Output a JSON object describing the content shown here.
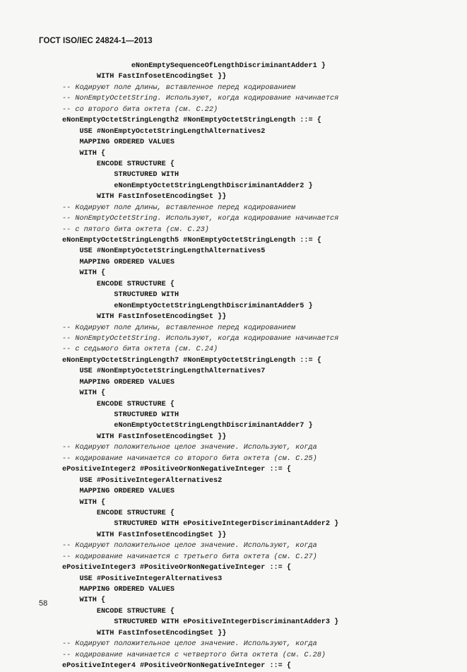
{
  "document": {
    "header": "ГОСТ ISO/IEC 24824-1—2013",
    "page_number": "58"
  },
  "code": {
    "lines": [
      {
        "text": "                eNonEmptySequenceOfLengthDiscriminantAdder1 }",
        "style": "kw"
      },
      {
        "text": "        WITH FastInfosetEncodingSet }}",
        "style": "kw"
      },
      {
        "text": "-- Кодируют поле длины, вставленное перед кодированием",
        "style": "cm"
      },
      {
        "text": "-- NonEmptyOctetString. Используют, когда кодирование начинается",
        "style": "cm"
      },
      {
        "text": "-- со второго бита октета (см. С.22)",
        "style": "cm"
      },
      {
        "text": "eNonEmptyOctetStringLength2 #NonEmptyOctetStringLength ::= {",
        "style": "kw"
      },
      {
        "text": "    USE #NonEmptyOctetStringLengthAlternatives2",
        "style": "kw"
      },
      {
        "text": "    MAPPING ORDERED VALUES",
        "style": "kw"
      },
      {
        "text": "    WITH {",
        "style": "kw"
      },
      {
        "text": "        ENCODE STRUCTURE {",
        "style": "kw"
      },
      {
        "text": "            STRUCTURED WITH",
        "style": "kw"
      },
      {
        "text": "            eNonEmptyOctetStringLengthDiscriminantAdder2 }",
        "style": "kw"
      },
      {
        "text": "        WITH FastInfosetEncodingSet }}",
        "style": "kw"
      },
      {
        "text": "-- Кодируют поле длины, вставленное перед кодированием",
        "style": "cm"
      },
      {
        "text": "-- NonEmptyOctetString. Используют, когда кодирование начинается",
        "style": "cm"
      },
      {
        "text": "-- с пятого бита октета (см. С.23)",
        "style": "cm"
      },
      {
        "text": "eNonEmptyOctetStringLength5 #NonEmptyOctetStringLength ::= {",
        "style": "kw"
      },
      {
        "text": "    USE #NonEmptyOctetStringLengthAlternatives5",
        "style": "kw"
      },
      {
        "text": "    MAPPING ORDERED VALUES",
        "style": "kw"
      },
      {
        "text": "    WITH {",
        "style": "kw"
      },
      {
        "text": "        ENCODE STRUCTURE {",
        "style": "kw"
      },
      {
        "text": "            STRUCTURED WITH",
        "style": "kw"
      },
      {
        "text": "            eNonEmptyOctetStringLengthDiscriminantAdder5 }",
        "style": "kw"
      },
      {
        "text": "        WITH FastInfosetEncodingSet }}",
        "style": "kw"
      },
      {
        "text": "-- Кодируют поле длины, вставленное перед кодированием",
        "style": "cm"
      },
      {
        "text": "-- NonEmptyOctetString. Используют, когда кодирование начинается",
        "style": "cm"
      },
      {
        "text": "-- с седьмого бита октета (см. С.24)",
        "style": "cm"
      },
      {
        "text": "eNonEmptyOctetStringLength7 #NonEmptyOctetStringLength ::= {",
        "style": "kw"
      },
      {
        "text": "    USE #NonEmptyOctetStringLengthAlternatives7",
        "style": "kw"
      },
      {
        "text": "    MAPPING ORDERED VALUES",
        "style": "kw"
      },
      {
        "text": "    WITH {",
        "style": "kw"
      },
      {
        "text": "        ENCODE STRUCTURE {",
        "style": "kw"
      },
      {
        "text": "            STRUCTURED WITH",
        "style": "kw"
      },
      {
        "text": "            eNonEmptyOctetStringLengthDiscriminantAdder7 }",
        "style": "kw"
      },
      {
        "text": "        WITH FastInfosetEncodingSet }}",
        "style": "kw"
      },
      {
        "text": "-- Кодируют положительное целое значение. Используют, когда",
        "style": "cm"
      },
      {
        "text": "-- кодирование начинается со второго бита октета (см. С.25)",
        "style": "cm"
      },
      {
        "text": "ePositiveInteger2 #PositiveOrNonNegativeInteger ::= {",
        "style": "kw"
      },
      {
        "text": "    USE #PositiveIntegerAlternatives2",
        "style": "kw"
      },
      {
        "text": "    MAPPING ORDERED VALUES",
        "style": "kw"
      },
      {
        "text": "    WITH {",
        "style": "kw"
      },
      {
        "text": "        ENCODE STRUCTURE {",
        "style": "kw"
      },
      {
        "text": "            STRUCTURED WITH ePositiveIntegerDiscriminantAdder2 }",
        "style": "kw"
      },
      {
        "text": "        WITH FastInfosetEncodingSet }}",
        "style": "kw"
      },
      {
        "text": "-- Кодируют положительное целое значение. Используют, когда",
        "style": "cm"
      },
      {
        "text": "-- кодирование начинается с третьего бита октета (см. С.27)",
        "style": "cm"
      },
      {
        "text": "ePositiveInteger3 #PositiveOrNonNegativeInteger ::= {",
        "style": "kw"
      },
      {
        "text": "    USE #PositiveIntegerAlternatives3",
        "style": "kw"
      },
      {
        "text": "    MAPPING ORDERED VALUES",
        "style": "kw"
      },
      {
        "text": "    WITH {",
        "style": "kw"
      },
      {
        "text": "        ENCODE STRUCTURE {",
        "style": "kw"
      },
      {
        "text": "            STRUCTURED WITH ePositiveIntegerDiscriminantAdder3 }",
        "style": "kw"
      },
      {
        "text": "        WITH FastInfosetEncodingSet }}",
        "style": "kw"
      },
      {
        "text": "-- Кодируют положительное целое значение. Используют, когда",
        "style": "cm"
      },
      {
        "text": "-- кодирование начинается с четвертого бита октета (см. С.28)",
        "style": "cm"
      },
      {
        "text": "ePositiveInteger4 #PositiveOrNonNegativeInteger ::= {",
        "style": "kw"
      }
    ]
  }
}
